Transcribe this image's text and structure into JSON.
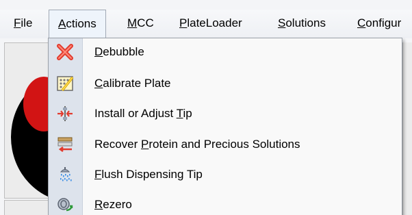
{
  "menubar": {
    "items": [
      {
        "label": "File",
        "mnemonic": "F",
        "rest": "ile"
      },
      {
        "label": "Actions",
        "mnemonic": "A",
        "rest": "ctions",
        "active": true
      },
      {
        "label": "MCC",
        "mnemonic": "M",
        "rest": "CC"
      },
      {
        "label": "PlateLoader",
        "mnemonic": "P",
        "rest": "lateLoader"
      },
      {
        "label": "Solutions",
        "mnemonic": "S",
        "rest": "olutions"
      },
      {
        "label": "Configur",
        "mnemonic": "C",
        "rest": "onfigur"
      }
    ]
  },
  "actions_menu": {
    "items": [
      {
        "pre": "",
        "mnemonic": "D",
        "post": "ebubble",
        "icon": "red-x-icon"
      },
      {
        "pre": "",
        "mnemonic": "C",
        "post": "alibrate Plate",
        "icon": "calibrate-grid-icon"
      },
      {
        "pre": "Install or Adjust ",
        "mnemonic": "T",
        "post": "ip",
        "icon": "adjust-arrows-icon"
      },
      {
        "pre": "Recover ",
        "mnemonic": "P",
        "post": "rotein and Precious Solutions",
        "icon": "recover-arrow-icon"
      },
      {
        "pre": "",
        "mnemonic": "F",
        "post": "lush Dispensing Tip",
        "icon": "shower-icon"
      },
      {
        "pre": "",
        "mnemonic": "R",
        "post": "ezero",
        "icon": "rezero-icon"
      }
    ]
  }
}
